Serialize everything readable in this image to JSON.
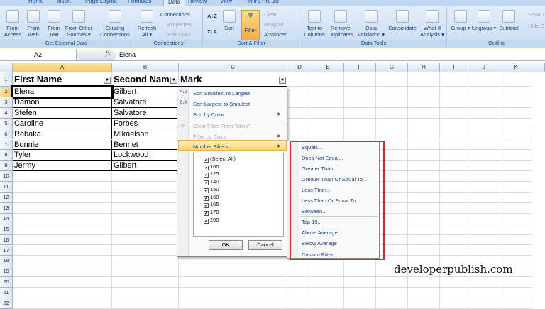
{
  "ribbon": {
    "tabs": [
      "Home",
      "Insert",
      "Page Layout",
      "Formulas",
      "Data",
      "Review",
      "View",
      "Nitro Pro 10"
    ],
    "active_tab": "Data",
    "groups": {
      "external": "Get External Data",
      "connections": "Connections",
      "sort_filter": "Sort & Filter",
      "data_tools": "Data Tools",
      "outline": "Outline"
    },
    "buttons": {
      "from_access": "From Access",
      "from_web": "From Web",
      "from_text": "From Text",
      "from_other": "From Other Sources ▾",
      "existing": "Existing Connections",
      "refresh": "Refresh All ▾",
      "connections": "Connections",
      "properties": "Properties",
      "edit_links": "Edit Links",
      "sort": "Sort",
      "filter": "Filter",
      "clear": "Clear",
      "reapply": "Reapply",
      "advanced": "Advanced",
      "text_to_columns": "Text to Columns",
      "remove_dup": "Remove Duplicates",
      "data_validation": "Data Validation ▾",
      "consolidate": "Consolidate",
      "what_if": "What-If Analysis ▾",
      "group": "Group ▾",
      "ungroup": "Ungroup ▾",
      "subtotal": "Subtotal",
      "show_detail": "Show D",
      "hide_detail": "Hide D"
    }
  },
  "formula_bar": {
    "name_box": "A2",
    "fx": "fx",
    "value": "Elena"
  },
  "columns": [
    "A",
    "B",
    "C",
    "D",
    "E",
    "F",
    "G",
    "H",
    "I",
    "J",
    "K"
  ],
  "rows": [
    "1",
    "2",
    "3",
    "4",
    "5",
    "6",
    "7",
    "8",
    "9",
    "10",
    "11",
    "12",
    "13",
    "14",
    "15",
    "16",
    "17",
    "18",
    "19",
    "20",
    "21",
    "22"
  ],
  "table": {
    "headers": [
      "First Name",
      "Second Name",
      "Mark"
    ],
    "data": [
      [
        "Elena",
        "Gilbert"
      ],
      [
        "Damon",
        "Salvatore"
      ],
      [
        "Stefen",
        "Salvatore"
      ],
      [
        "Caroline",
        "Forbes"
      ],
      [
        "Rebaka",
        "Mikaelson"
      ],
      [
        "Bonnie",
        "Bennet"
      ],
      [
        "Tyler",
        "Lockwood"
      ],
      [
        "Jermy",
        "Gilbert"
      ]
    ]
  },
  "filter_menu": {
    "items": [
      "Sort Smallest to Largest",
      "Sort Largest to Smallest",
      "Sort by Color",
      "Clear Filter From \"Mark\"",
      "Filter by Color",
      "Number Filters"
    ],
    "values": [
      "(Select All)",
      "100",
      "125",
      "140",
      "150",
      "160",
      "165",
      "178",
      "200"
    ],
    "ok": "OK",
    "cancel": "Cancel"
  },
  "number_filters": [
    "Equals...",
    "Does Not Equal...",
    "Greater Than...",
    "Greater Than Or Equal To...",
    "Less Than...",
    "Less Than Or Equal To...",
    "Between...",
    "Top 10...",
    "Above Average",
    "Below Average",
    "Custom Filter..."
  ],
  "watermark": "developerpublish.com",
  "colors": {
    "highlight": "#e8202a",
    "accent": "#15428b"
  }
}
